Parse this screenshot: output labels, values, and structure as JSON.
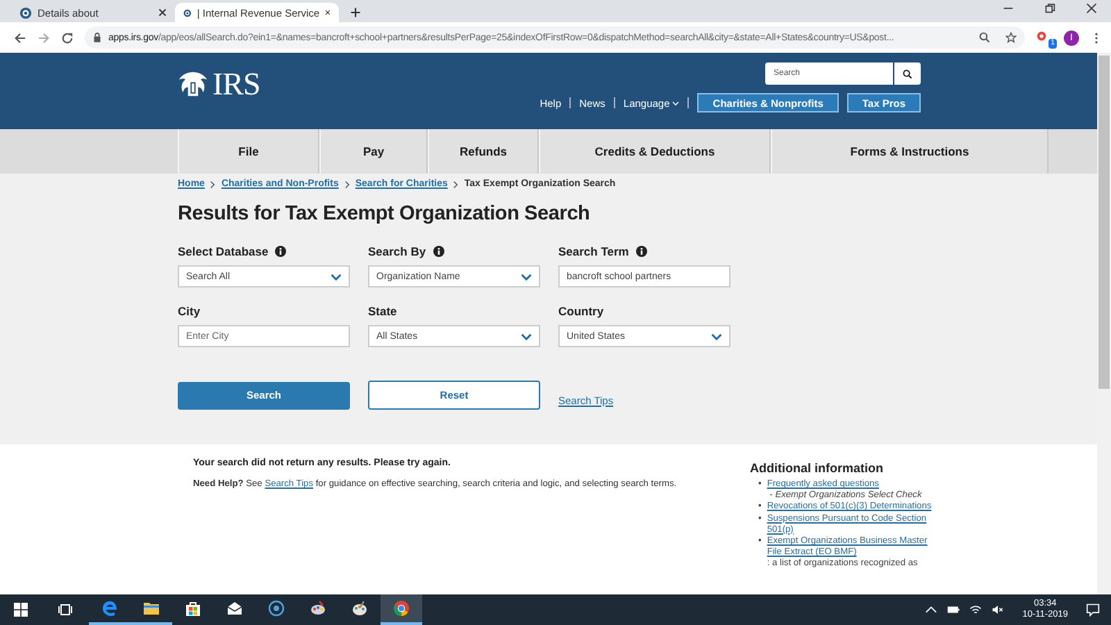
{
  "browser": {
    "tabs": [
      {
        "title": "Details about",
        "selected": false
      },
      {
        "title": "| Internal Revenue Service",
        "selected": true
      }
    ],
    "url_host": "apps.irs.gov",
    "url_path": "/app/eos/allSearch.do?ein1=&names=bancroft+school+partners&resultsPerPage=25&indexOfFirstRow=0&dispatchMethod=searchAll&city=&state=All+States&country=US&post...",
    "extension_badge": "1",
    "profile_initial": "I"
  },
  "header": {
    "logo": "IRS",
    "search": {
      "placeholder": "Search"
    },
    "links": [
      {
        "label": "Help",
        "kind": "link"
      },
      {
        "label": "News",
        "kind": "link"
      },
      {
        "label": "Language",
        "kind": "menu"
      }
    ],
    "buttons": [
      "Charities & Nonprofits",
      "Tax Pros"
    ]
  },
  "nav": [
    "File",
    "Pay",
    "Refunds",
    "Credits & Deductions",
    "Forms & Instructions"
  ],
  "breadcrumbs": [
    {
      "label": "Home",
      "kind": "link"
    },
    {
      "label": "Charities and Non-Profits",
      "kind": "link"
    },
    {
      "label": "Search for Charities",
      "kind": "link"
    },
    {
      "label": "Tax Exempt Organization Search",
      "kind": "current"
    }
  ],
  "heading": "Results for Tax Exempt Organization Search",
  "fields": [
    {
      "label": "Select Database",
      "info": true,
      "kind": "select",
      "value": "Search All"
    },
    {
      "label": "Search By",
      "info": true,
      "kind": "select",
      "value": "Organization Name"
    },
    {
      "label": "Search Term",
      "info": true,
      "kind": "input",
      "value": "bancroft school partners"
    },
    {
      "label": "City",
      "info": false,
      "kind": "input",
      "placeholder": "Enter City"
    },
    {
      "label": "State",
      "info": false,
      "kind": "select",
      "value": "All States"
    },
    {
      "label": "Country",
      "info": false,
      "kind": "select",
      "value": "United States"
    }
  ],
  "actions": {
    "search": "Search",
    "reset": "Reset",
    "tips": "Search Tips"
  },
  "message": "Your search did not return any results. Please try again.",
  "help": {
    "before": "**Need Help?** See ",
    "link": "Search Tips",
    "after": " for guidance on effective searching, search criteria and logic, and selecting search terms."
  },
  "sidebar": {
    "title": "Additional information",
    "items": [
      {
        "marker": "•",
        "link": "Frequently asked questions",
        "rest": " - *Exempt Organizations Select Check*"
      },
      {
        "marker": "•",
        "link": "Revocations of 501(c)(3) Determinations"
      },
      {
        "marker": "•",
        "link": "Suspensions Pursuant to Code Section 501(p)"
      },
      {
        "marker": "•",
        "link": "Exempt Organizations Business Master File Extract (EO BMF)",
        "rest": ": a list of organizations recognized as"
      }
    ]
  },
  "taskbar": {
    "apps": [
      {
        "kind": "edge",
        "running": true,
        "selected": false
      },
      {
        "kind": "explorer",
        "running": true,
        "selected": false
      },
      {
        "kind": "store",
        "running": false,
        "selected": false
      },
      {
        "kind": "mail",
        "running": false,
        "selected": false
      },
      {
        "kind": "circle",
        "running": false,
        "selected": false
      },
      {
        "kind": "paint",
        "running": false,
        "selected": false
      },
      {
        "kind": "palette",
        "running": false,
        "selected": false
      },
      {
        "kind": "chrome",
        "running": true,
        "selected": true
      }
    ],
    "time": "03:34",
    "date": "10-11-2019"
  }
}
